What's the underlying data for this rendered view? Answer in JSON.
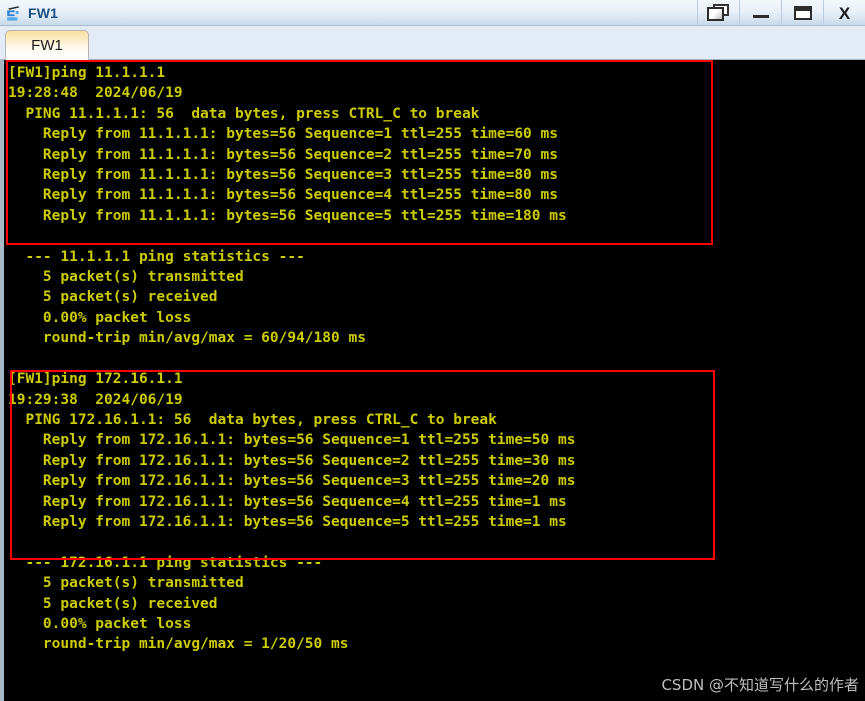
{
  "window": {
    "title": "FW1",
    "icon": "device-icon",
    "controls": [
      {
        "name": "restore-button",
        "icon": "restore-icon",
        "label": ""
      },
      {
        "name": "minimize-button",
        "icon": "minimize-icon",
        "label": ""
      },
      {
        "name": "maximize-button",
        "icon": "maximize-icon",
        "label": ""
      },
      {
        "name": "close-button",
        "icon": "close-icon",
        "label": "X"
      }
    ]
  },
  "tabs": [
    {
      "label": "FW1",
      "active": true
    }
  ],
  "terminal": {
    "foreground": "#cccc00",
    "background": "#000000",
    "highlight_color": "#ff0000",
    "lines": [
      "[FW1]ping 11.1.1.1",
      "19:28:48  2024/06/19",
      "  PING 11.1.1.1: 56  data bytes, press CTRL_C to break",
      "    Reply from 11.1.1.1: bytes=56 Sequence=1 ttl=255 time=60 ms",
      "    Reply from 11.1.1.1: bytes=56 Sequence=2 ttl=255 time=70 ms",
      "    Reply from 11.1.1.1: bytes=56 Sequence=3 ttl=255 time=80 ms",
      "    Reply from 11.1.1.1: bytes=56 Sequence=4 ttl=255 time=80 ms",
      "    Reply from 11.1.1.1: bytes=56 Sequence=5 ttl=255 time=180 ms",
      "",
      "  --- 11.1.1.1 ping statistics ---",
      "    5 packet(s) transmitted",
      "    5 packet(s) received",
      "    0.00% packet loss",
      "    round-trip min/avg/max = 60/94/180 ms",
      "",
      "[FW1]ping 172.16.1.1",
      "19:29:38  2024/06/19",
      "  PING 172.16.1.1: 56  data bytes, press CTRL_C to break",
      "    Reply from 172.16.1.1: bytes=56 Sequence=1 ttl=255 time=50 ms",
      "    Reply from 172.16.1.1: bytes=56 Sequence=2 ttl=255 time=30 ms",
      "    Reply from 172.16.1.1: bytes=56 Sequence=3 ttl=255 time=20 ms",
      "    Reply from 172.16.1.1: bytes=56 Sequence=4 ttl=255 time=1 ms",
      "    Reply from 172.16.1.1: bytes=56 Sequence=5 ttl=255 time=1 ms",
      "",
      "  --- 172.16.1.1 ping statistics ---",
      "    5 packet(s) transmitted",
      "    5 packet(s) received",
      "    0.00% packet loss",
      "    round-trip min/avg/max = 1/20/50 ms"
    ]
  },
  "watermark": {
    "text": "CSDN @不知道写什么的作者"
  }
}
